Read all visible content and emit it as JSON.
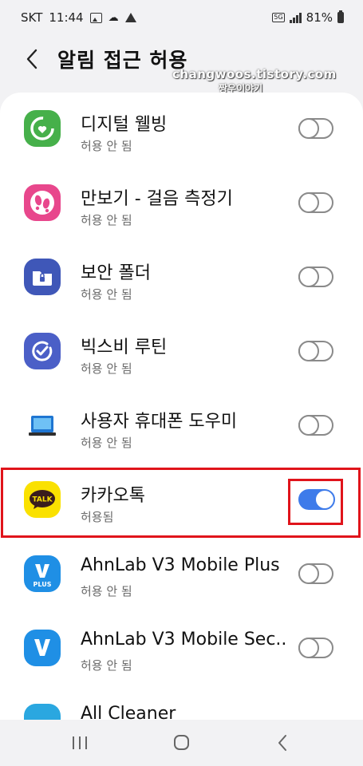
{
  "status_bar": {
    "carrier": "SKT",
    "time": "11:44",
    "network": "5G",
    "battery": "81%"
  },
  "header": {
    "title": "알림 접근 허용",
    "watermark_url": "changwoos.tistory.com",
    "watermark_name": "짱우이야기"
  },
  "apps": [
    {
      "name": "디지털 웰빙",
      "status": "허용 안 됨",
      "enabled": false,
      "icon": "digital-wellbeing-icon"
    },
    {
      "name": "만보기 - 걸음 측정기",
      "status": "허용 안 됨",
      "enabled": false,
      "icon": "pedometer-icon"
    },
    {
      "name": "보안 폴더",
      "status": "허용 안 됨",
      "enabled": false,
      "icon": "secure-folder-icon"
    },
    {
      "name": "빅스비 루틴",
      "status": "허용 안 됨",
      "enabled": false,
      "icon": "bixby-routines-icon"
    },
    {
      "name": "사용자 휴대폰 도우미",
      "status": "허용 안 됨",
      "enabled": false,
      "icon": "phone-helper-icon"
    },
    {
      "name": "카카오톡",
      "status": "허용됨",
      "enabled": true,
      "icon": "kakaotalk-icon",
      "icon_text": "TALK"
    },
    {
      "name": "AhnLab V3 Mobile Plus",
      "status": "허용 안 됨",
      "enabled": false,
      "icon": "v3-plus-icon",
      "icon_text": "PLUS"
    },
    {
      "name": "AhnLab V3 Mobile Sec..",
      "status": "허용 안 됨",
      "enabled": false,
      "icon": "v3-security-icon"
    },
    {
      "name": "All Cleaner",
      "status": "",
      "enabled": false,
      "icon": "all-cleaner-icon"
    }
  ],
  "colors": {
    "toggle_on": "#3e7bea",
    "highlight": "#e0141b",
    "background": "#f2f2f4"
  }
}
